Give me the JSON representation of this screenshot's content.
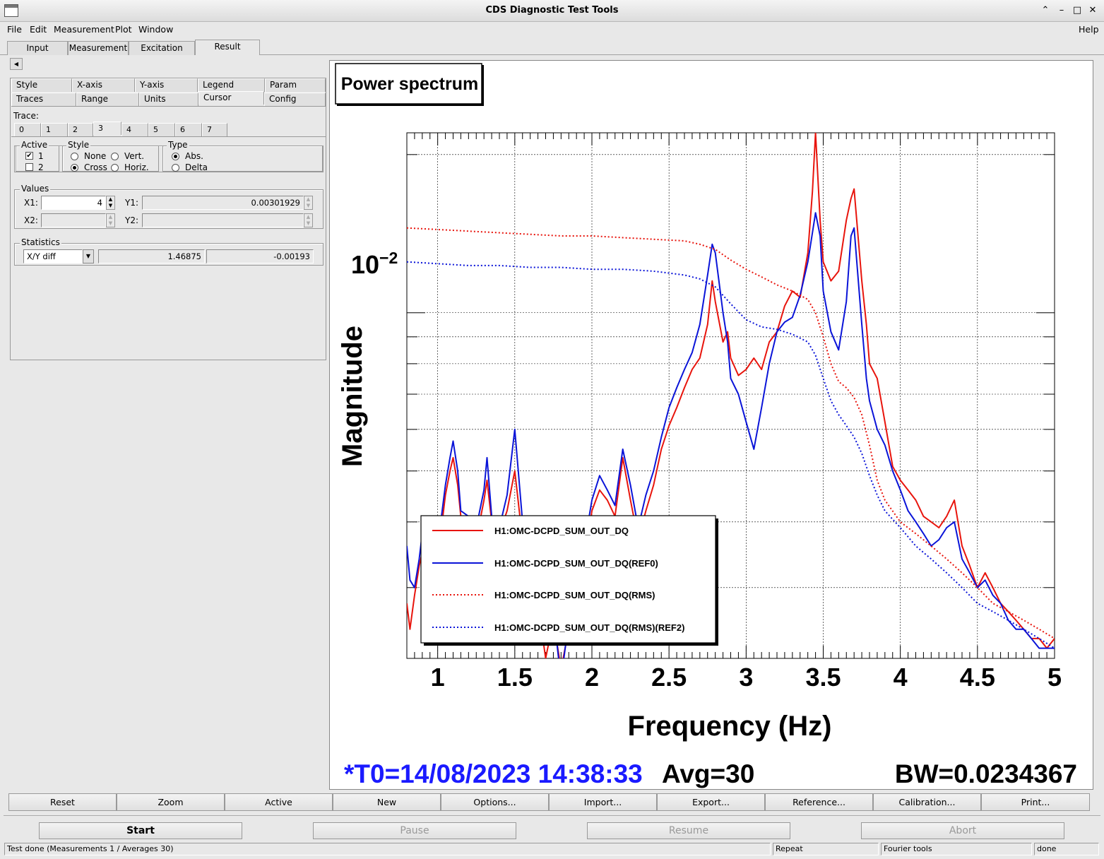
{
  "window": {
    "title": "CDS Diagnostic Test Tools"
  },
  "menu": {
    "file": "File",
    "edit": "Edit",
    "measurement": "Measurement",
    "plot": "Plot",
    "window": "Window",
    "help": "Help"
  },
  "main_tabs": [
    "Input",
    "Measurement",
    "Excitation",
    "Result"
  ],
  "options_tabs_row1": [
    "Style",
    "X-axis",
    "Y-axis",
    "Legend",
    "Param"
  ],
  "options_tabs_row2": [
    "Traces",
    "Range",
    "Units",
    "Cursor",
    "Config"
  ],
  "trace": {
    "label": "Trace:",
    "tabs": [
      "0",
      "1",
      "2",
      "3",
      "4",
      "5",
      "6",
      "7"
    ],
    "selected": "3"
  },
  "active": {
    "label": "Active",
    "opt1": "1",
    "opt2": "2"
  },
  "style": {
    "label": "Style",
    "none": "None",
    "vert": "Vert.",
    "cross": "Cross",
    "horiz": "Horiz."
  },
  "type": {
    "label": "Type",
    "abs": "Abs.",
    "delta": "Delta"
  },
  "values": {
    "label": "Values",
    "x1_label": "X1:",
    "x1": "4",
    "y1_label": "Y1:",
    "y1": "0.00301929",
    "x2_label": "X2:",
    "y2_label": "Y2:"
  },
  "statistics": {
    "label": "Statistics",
    "mode": "X/Y diff",
    "v1": "1.46875",
    "v2": "-0.00193"
  },
  "plot": {
    "title": "Power spectrum",
    "ylabel": "Magnitude",
    "xlabel": "Frequency (Hz)",
    "y_tick_base": "10",
    "y_tick_exp": "−2",
    "x_ticks": [
      "1",
      "1.5",
      "2",
      "2.5",
      "3",
      "3.5",
      "4",
      "4.5",
      "5"
    ],
    "t0": "*T0=14/08/2023 14:38:33",
    "avg": "Avg=30",
    "bw": "BW=0.0234367",
    "colors": {
      "red": "#e8140c",
      "blue": "#0a14d8",
      "t0_text": "#1a1aff"
    }
  },
  "chart_data": {
    "type": "line",
    "title": "Power spectrum",
    "xlabel": "Frequency (Hz)",
    "ylabel": "Magnitude",
    "xlim": [
      0.8,
      5.0
    ],
    "ylim": [
      0.0022,
      0.022
    ],
    "y_scale": "log",
    "grid": true,
    "legend_position": "bottom-left",
    "series": [
      {
        "name": "H1:OMC-DCPD_SUM_OUT_DQ",
        "color": "#e8140c",
        "style": "solid",
        "x": [
          0.8,
          0.82,
          0.85,
          0.88,
          0.9,
          0.92,
          0.95,
          0.98,
          1.0,
          1.05,
          1.08,
          1.1,
          1.13,
          1.15,
          1.2,
          1.25,
          1.3,
          1.32,
          1.35,
          1.38,
          1.4,
          1.45,
          1.5,
          1.55,
          1.6,
          1.62,
          1.65,
          1.7,
          1.75,
          1.8,
          1.85,
          1.9,
          1.95,
          2.0,
          2.05,
          2.1,
          2.15,
          2.2,
          2.25,
          2.3,
          2.35,
          2.4,
          2.45,
          2.5,
          2.55,
          2.6,
          2.65,
          2.7,
          2.75,
          2.78,
          2.8,
          2.85,
          2.88,
          2.9,
          2.95,
          3.0,
          3.05,
          3.1,
          3.15,
          3.2,
          3.25,
          3.3,
          3.35,
          3.4,
          3.43,
          3.45,
          3.48,
          3.5,
          3.55,
          3.6,
          3.65,
          3.68,
          3.7,
          3.75,
          3.78,
          3.8,
          3.85,
          3.9,
          3.95,
          4.0,
          4.05,
          4.1,
          4.15,
          4.2,
          4.25,
          4.3,
          4.35,
          4.4,
          4.45,
          4.5,
          4.55,
          4.6,
          4.65,
          4.7,
          4.75,
          4.8,
          4.85,
          4.9,
          4.95,
          5.0
        ],
        "y": [
          0.0028,
          0.0025,
          0.0029,
          0.0033,
          0.0035,
          0.0034,
          0.0033,
          0.003,
          0.0034,
          0.0045,
          0.005,
          0.0053,
          0.0047,
          0.0041,
          0.004,
          0.0037,
          0.0044,
          0.0048,
          0.004,
          0.0034,
          0.0038,
          0.0042,
          0.005,
          0.0037,
          0.0033,
          0.003,
          0.0028,
          0.0022,
          0.0026,
          0.0021,
          0.0025,
          0.003,
          0.0033,
          0.0042,
          0.0046,
          0.0044,
          0.0041,
          0.0053,
          0.0044,
          0.0037,
          0.0042,
          0.0047,
          0.0055,
          0.0061,
          0.0066,
          0.0072,
          0.0078,
          0.0082,
          0.0095,
          0.0115,
          0.0105,
          0.0088,
          0.0092,
          0.0082,
          0.0076,
          0.0078,
          0.0082,
          0.0078,
          0.0088,
          0.0092,
          0.0103,
          0.011,
          0.0107,
          0.013,
          0.017,
          0.022,
          0.015,
          0.0125,
          0.0115,
          0.012,
          0.015,
          0.0165,
          0.0172,
          0.0115,
          0.0095,
          0.008,
          0.0075,
          0.0062,
          0.0051,
          0.0048,
          0.0046,
          0.0044,
          0.0041,
          0.004,
          0.0039,
          0.0041,
          0.0044,
          0.0036,
          0.0033,
          0.003,
          0.0032,
          0.003,
          0.0028,
          0.0027,
          0.0026,
          0.0025,
          0.0024,
          0.0024,
          0.0023,
          0.0024
        ]
      },
      {
        "name": "H1:OMC-DCPD_SUM_OUT_DQ(REF0)",
        "color": "#0a14d8",
        "style": "solid",
        "x": [
          0.8,
          0.82,
          0.85,
          0.88,
          0.9,
          0.92,
          0.95,
          0.98,
          1.0,
          1.05,
          1.08,
          1.1,
          1.13,
          1.15,
          1.2,
          1.25,
          1.3,
          1.32,
          1.35,
          1.38,
          1.4,
          1.45,
          1.5,
          1.55,
          1.6,
          1.62,
          1.65,
          1.7,
          1.75,
          1.8,
          1.85,
          1.9,
          1.95,
          2.0,
          2.05,
          2.1,
          2.15,
          2.2,
          2.25,
          2.3,
          2.35,
          2.4,
          2.45,
          2.5,
          2.55,
          2.6,
          2.65,
          2.7,
          2.75,
          2.78,
          2.8,
          2.85,
          2.88,
          2.9,
          2.95,
          3.0,
          3.05,
          3.1,
          3.15,
          3.2,
          3.25,
          3.3,
          3.35,
          3.4,
          3.43,
          3.45,
          3.48,
          3.5,
          3.55,
          3.6,
          3.65,
          3.68,
          3.7,
          3.75,
          3.78,
          3.8,
          3.85,
          3.9,
          3.95,
          4.0,
          4.05,
          4.1,
          4.15,
          4.2,
          4.25,
          4.3,
          4.35,
          4.4,
          4.45,
          4.5,
          4.55,
          4.6,
          4.65,
          4.7,
          4.75,
          4.8,
          4.85,
          4.9,
          4.95,
          5.0
        ],
        "y": [
          0.0036,
          0.0031,
          0.003,
          0.0034,
          0.0038,
          0.0032,
          0.0029,
          0.0031,
          0.0036,
          0.0047,
          0.0053,
          0.0057,
          0.005,
          0.0042,
          0.0041,
          0.0039,
          0.0046,
          0.0053,
          0.0041,
          0.0036,
          0.0039,
          0.0045,
          0.006,
          0.004,
          0.0035,
          0.0033,
          0.003,
          0.0024,
          0.0027,
          0.002,
          0.0026,
          0.0032,
          0.0036,
          0.0044,
          0.0049,
          0.0046,
          0.0043,
          0.0055,
          0.0047,
          0.0039,
          0.0045,
          0.005,
          0.0058,
          0.0066,
          0.0072,
          0.0078,
          0.0084,
          0.0095,
          0.0118,
          0.0135,
          0.013,
          0.01,
          0.0088,
          0.0075,
          0.007,
          0.0062,
          0.0055,
          0.0066,
          0.008,
          0.0092,
          0.0096,
          0.0098,
          0.0108,
          0.0125,
          0.0142,
          0.0155,
          0.014,
          0.011,
          0.0092,
          0.0085,
          0.0105,
          0.014,
          0.0145,
          0.0095,
          0.0075,
          0.0068,
          0.006,
          0.0056,
          0.005,
          0.0046,
          0.0042,
          0.004,
          0.0038,
          0.0036,
          0.0037,
          0.0039,
          0.004,
          0.0034,
          0.0032,
          0.003,
          0.0031,
          0.0029,
          0.0028,
          0.0026,
          0.0025,
          0.0025,
          0.0024,
          0.0023,
          0.0023,
          0.0023
        ]
      },
      {
        "name": "H1:OMC-DCPD_SUM_OUT_DQ(RMS)",
        "color": "#e8140c",
        "style": "dotted",
        "x": [
          0.8,
          1.0,
          1.2,
          1.4,
          1.6,
          1.8,
          2.0,
          2.2,
          2.4,
          2.6,
          2.7,
          2.8,
          2.9,
          3.0,
          3.1,
          3.2,
          3.3,
          3.4,
          3.45,
          3.5,
          3.55,
          3.6,
          3.65,
          3.7,
          3.75,
          3.8,
          3.85,
          3.9,
          4.0,
          4.1,
          4.2,
          4.3,
          4.4,
          4.5,
          4.6,
          4.7,
          4.8,
          4.9,
          5.0
        ],
        "y": [
          0.0145,
          0.0144,
          0.0143,
          0.0142,
          0.0141,
          0.014,
          0.014,
          0.0139,
          0.0138,
          0.0137,
          0.0135,
          0.0132,
          0.0126,
          0.0121,
          0.0117,
          0.0113,
          0.011,
          0.0106,
          0.01,
          0.009,
          0.008,
          0.0074,
          0.0072,
          0.0069,
          0.0064,
          0.0056,
          0.0048,
          0.0044,
          0.004,
          0.0038,
          0.0036,
          0.0034,
          0.0032,
          0.003,
          0.0028,
          0.0027,
          0.0026,
          0.0025,
          0.0024
        ]
      },
      {
        "name": "H1:OMC-DCPD_SUM_OUT_DQ(RMS)(REF2)",
        "color": "#0a14d8",
        "style": "dotted",
        "x": [
          0.8,
          1.0,
          1.2,
          1.4,
          1.6,
          1.8,
          2.0,
          2.2,
          2.4,
          2.6,
          2.7,
          2.8,
          2.9,
          3.0,
          3.1,
          3.2,
          3.3,
          3.4,
          3.45,
          3.5,
          3.55,
          3.6,
          3.65,
          3.7,
          3.75,
          3.8,
          3.85,
          3.9,
          4.0,
          4.1,
          4.2,
          4.3,
          4.4,
          4.5,
          4.6,
          4.7,
          4.8,
          4.9,
          5.0
        ],
        "y": [
          0.0125,
          0.0124,
          0.0123,
          0.0123,
          0.0122,
          0.0122,
          0.0121,
          0.0121,
          0.012,
          0.0118,
          0.0116,
          0.0112,
          0.0104,
          0.0097,
          0.0094,
          0.0093,
          0.0091,
          0.0088,
          0.0083,
          0.0075,
          0.0068,
          0.0064,
          0.0061,
          0.0058,
          0.0054,
          0.0049,
          0.0045,
          0.0042,
          0.0039,
          0.0036,
          0.0034,
          0.0032,
          0.003,
          0.0028,
          0.0027,
          0.0026,
          0.0025,
          0.0024,
          0.0023
        ]
      }
    ]
  },
  "buttons_row": [
    "Reset",
    "Zoom",
    "Active",
    "New",
    "Options...",
    "Import...",
    "Export...",
    "Reference...",
    "Calibration...",
    "Print..."
  ],
  "control_buttons": {
    "start": "Start",
    "pause": "Pause",
    "resume": "Resume",
    "abort": "Abort"
  },
  "statusbar": {
    "message": "Test done (Measurements 1 / Averages 30)",
    "mode": "Repeat",
    "tool": "Fourier tools",
    "state": "done"
  }
}
